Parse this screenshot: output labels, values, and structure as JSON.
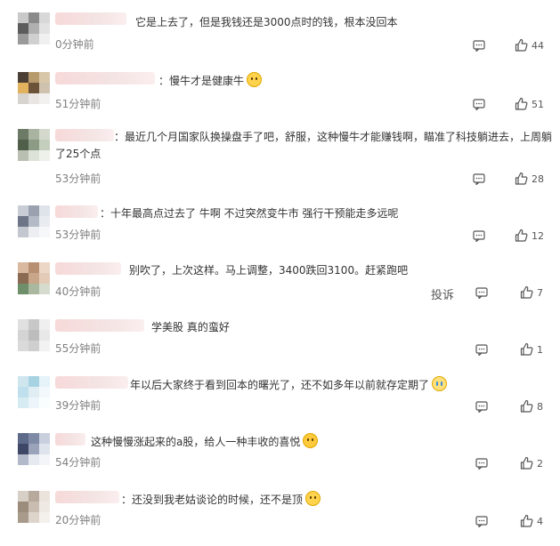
{
  "comments": [
    {
      "text": "它是上去了，但是我钱还是3000点时的钱，根本没回本",
      "time": "0分钟前",
      "likes": "44",
      "avatar": [
        "#c9c9c9",
        "#8a8a8a",
        "#d8d8d8",
        "#5c5c5c",
        "#b0b0b0",
        "#e2e2e2",
        "#9a9a9a",
        "#d0d0d0",
        "#f0f0f0"
      ]
    },
    {
      "text": "：慢牛才是健康牛",
      "time": "51分钟前",
      "likes": "51",
      "emoji": "cat-face",
      "avatar": [
        "#4b3f35",
        "#b89b6c",
        "#d8c7a8",
        "#e2b25f",
        "#6c5238",
        "#cfc3b0",
        "#d7d3cf",
        "#e9e6e3",
        "#f3f1ef"
      ]
    },
    {
      "text": "：最近几个月国家队换操盘手了吧，舒服，这种慢牛才能赚钱啊，瞄准了科技躺进去，上周躺了25个点",
      "time": "53分钟前",
      "likes": "28",
      "avatar": [
        "#6c7a66",
        "#a8b3a0",
        "#d3d9cc",
        "#4f5f4a",
        "#8c9b84",
        "#c5cebd",
        "#b9c0b2",
        "#dde2d8",
        "#eef1ea"
      ]
    },
    {
      "text": "：十年最高点过去了 牛啊 不过突然变牛市 强行干预能走多远呢",
      "time": "53分钟前",
      "likes": "12",
      "avatar": [
        "#c8cdd6",
        "#9aa2b0",
        "#dfe3ea",
        "#6d7588",
        "#b4bbc7",
        "#e8ebf0",
        "#c3c7cf",
        "#eceef2",
        "#f6f7f9"
      ]
    },
    {
      "text": "别吹了，上次这样。马上调整，3400跌回3100。赶紧跑吧",
      "time": "40分钟前",
      "likes": "7",
      "report": "投诉",
      "avatar": [
        "#d9b9a0",
        "#b98f71",
        "#ecd7c6",
        "#8a6a52",
        "#c9a58a",
        "#e3cbb8",
        "#6f8f6a",
        "#a9b89e",
        "#d5dccd"
      ]
    },
    {
      "text": "学美股 真的蛮好",
      "time": "55分钟前",
      "likes": "1",
      "avatar": [
        "#e0e0e0",
        "#c8c8c8",
        "#efefef",
        "#d4d4d4",
        "#bdbdbd",
        "#e8e8e8",
        "#dadada",
        "#cfcfcf",
        "#f2f2f2"
      ]
    },
    {
      "text": "年以后大家终于看到回本的曙光了，还不如多年以前就存定期了",
      "time": "39分钟前",
      "likes": "8",
      "emoji": "crying-face",
      "avatar": [
        "#cfe6ef",
        "#a7d2e2",
        "#e6f3f8",
        "#bfe0ec",
        "#e0eef4",
        "#f2f8fb",
        "#d7ebf2",
        "#ecf6fa",
        "#fafdfe"
      ]
    },
    {
      "text": "这种慢慢涨起来的a股，给人一种丰收的喜悦",
      "time": "54分钟前",
      "likes": "2",
      "emoji": "surprised-face",
      "avatar": [
        "#5d6a8a",
        "#7f8aa6",
        "#c9cfdd",
        "#3e4866",
        "#9aa3ba",
        "#dfe3ec",
        "#b2b9cb",
        "#e6e9f0",
        "#f4f5f8"
      ]
    },
    {
      "text": "：还没到我老姑谈论的时候，还不是顶",
      "time": "20分钟前",
      "likes": "4",
      "emoji": "cat-face",
      "avatar": [
        "#d8cfc6",
        "#b7aa9c",
        "#ebe4dd",
        "#9c8c7c",
        "#c9bdb1",
        "#efe9e3",
        "#a99b8c",
        "#ddd4cb",
        "#f4f0ec"
      ]
    }
  ],
  "colors": {
    "text": "#333333",
    "time": "#808080",
    "icon": "#555555"
  },
  "icons": {
    "reply": "comment-bubble-icon",
    "like": "thumbs-up-icon"
  }
}
